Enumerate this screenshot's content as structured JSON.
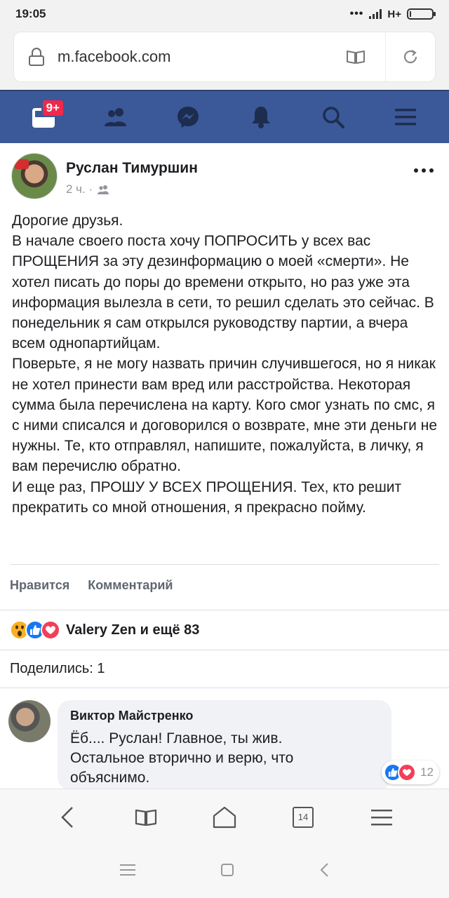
{
  "status_bar": {
    "time": "19:05",
    "network": "H+"
  },
  "browser": {
    "url": "m.facebook.com",
    "tab_count": "14"
  },
  "fb_nav": {
    "notification_badge": "9+"
  },
  "post": {
    "author": "Руслан Тимуршин",
    "time": "2 ч. ·",
    "text": "Дорогие друзья.\nВ начале своего поста хочу ПОПРОСИТЬ у всех вас ПРОЩЕНИЯ за эту дезинформацию о моей «смерти». Не хотел писать до поры до времени открыто, но раз уже эта информация вылезла в сети, то решил сделать это сейчас. В понедельник я сам открылся руководству партии, а вчера всем однопартийцам.\nПоверьте, я не могу назвать причин случившегося, но я никак не хотел принести вам вред или расстройства. Некоторая сумма была перечислена на карту. Кого смог узнать по смс, я с ними списался и договорился о возврате, мне эти деньги не нужны. Те, кто отправлял, напишите, пожалуйста, в личку, я вам перечислю обратно.\nИ еще раз, ПРОШУ У ВСЕХ ПРОЩЕНИЯ. Тех, кто решит прекратить со мной отношения, я прекрасно пойму.",
    "like_label": "Нравится",
    "comment_label": "Комментарий",
    "reactions_text": "Valery Zen и ещё 83",
    "shares_text": "Поделились: 1"
  },
  "comment": {
    "author": "Виктор Майстренко",
    "text": "Ёб.... Руслан! Главное, ты жив.\nОстальное вторично и верю, что\nобъяснимо.",
    "reaction_count": "12"
  },
  "colors": {
    "fb_blue": "#3b5998",
    "badge_red": "#f02849",
    "like_blue": "#1877f2",
    "love_red": "#f33e58",
    "wow_yellow": "#f7b125"
  }
}
